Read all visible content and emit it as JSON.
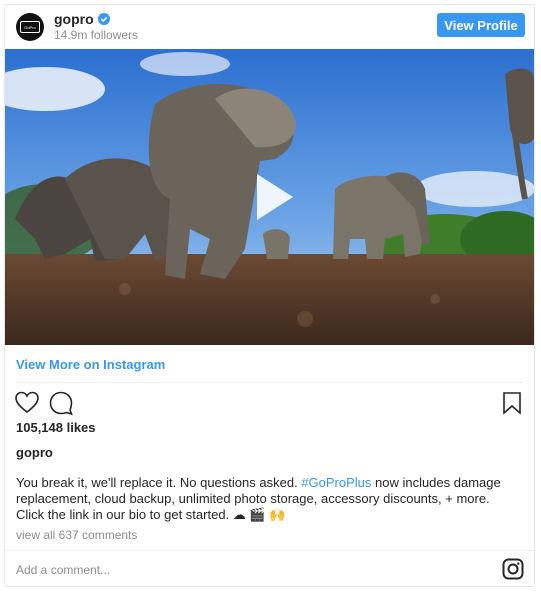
{
  "header": {
    "username": "gopro",
    "followers": "14.9m followers",
    "view_profile_label": "View Profile",
    "avatar_text": "GoPro"
  },
  "media": {
    "type": "video",
    "play_icon": "play-icon"
  },
  "links": {
    "view_more": "View More on Instagram"
  },
  "actions": {
    "like_icon": "heart-icon",
    "comment_icon": "comment-icon",
    "save_icon": "bookmark-icon"
  },
  "post": {
    "likes": "105,148 likes",
    "author": "gopro",
    "caption_before": "You break it, we'll replace it. No questions asked. ",
    "hashtag": "#GoProPlus",
    "caption_after": " now includes damage replacement, cloud backup, unlimited photo storage, accessory discounts, + more. Click the link in our bio to get started. ☁ 🎬 🙌",
    "comments_link": "view all 637 comments"
  },
  "comment_box": {
    "placeholder": "Add a comment...",
    "instagram_icon": "instagram-icon"
  },
  "colors": {
    "accent": "#3897f0",
    "muted": "#8e8e8e",
    "text": "#262626"
  }
}
